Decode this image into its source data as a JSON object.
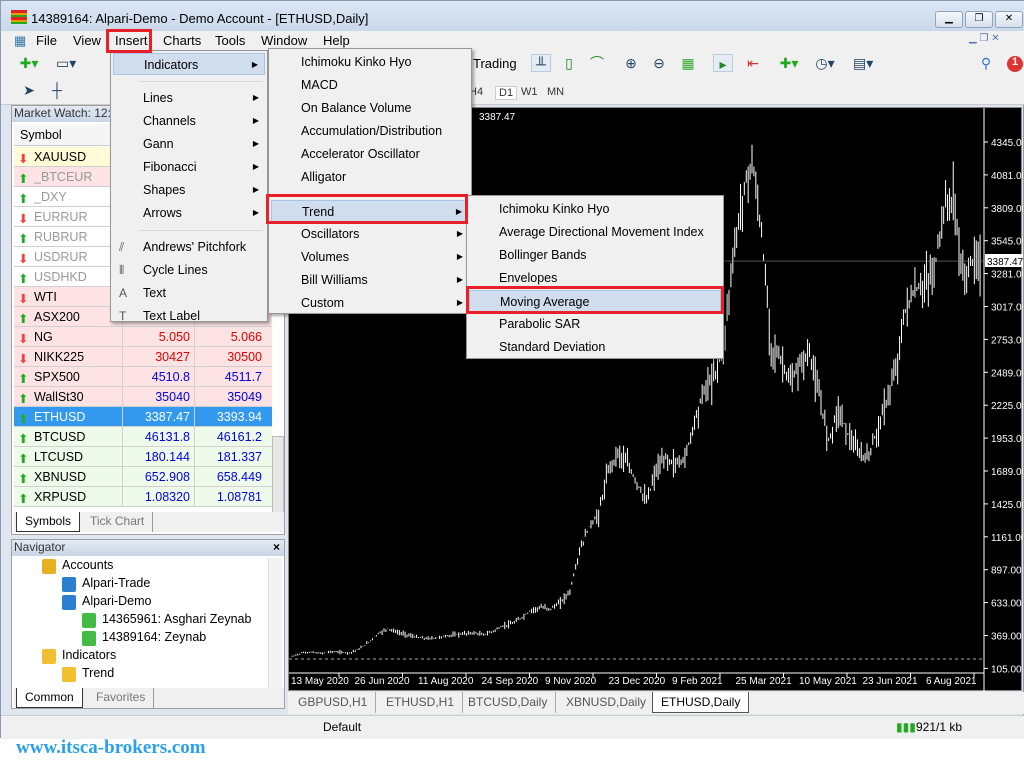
{
  "window": {
    "title": "14389164: Alpari-Demo - Demo Account - [ETHUSD,Daily]"
  },
  "menubar": [
    "File",
    "View",
    "Insert",
    "Charts",
    "Tools",
    "Window",
    "Help"
  ],
  "toolbar": {
    "autotrading_label": "Trading",
    "timeframes": [
      "H4",
      "D1",
      "W1",
      "MN"
    ],
    "notification_count": "1"
  },
  "market_watch": {
    "title": "Market Watch: 12:5",
    "col_symbol": "Symbol",
    "rows": [
      {
        "symbol": "XAUUSD",
        "dir": "down",
        "bid": "",
        "ask": "",
        "bg": "#fffbd6"
      },
      {
        "symbol": "_BTCEUR",
        "dir": "up",
        "bid": "",
        "ask": "",
        "bg": "#fde3e3",
        "dim": true
      },
      {
        "symbol": "_DXY",
        "dir": "up",
        "bid": "",
        "ask": "",
        "bg": "#ffffff",
        "dim": true
      },
      {
        "symbol": "EURRUR",
        "dir": "down",
        "bid": "",
        "ask": "",
        "bg": "#ffffff",
        "dim": true
      },
      {
        "symbol": "RUBRUR",
        "dir": "up",
        "bid": "",
        "ask": "",
        "bg": "#ffffff",
        "dim": true
      },
      {
        "symbol": "USDRUR",
        "dir": "down",
        "bid": "",
        "ask": "",
        "bg": "#ffffff",
        "dim": true
      },
      {
        "symbol": "USDHKD",
        "dir": "up",
        "bid": "",
        "ask": "",
        "bg": "#ffffff",
        "dim": true
      },
      {
        "symbol": "WTI",
        "dir": "down",
        "bid": "",
        "ask": "",
        "bg": "#fde3e3"
      },
      {
        "symbol": "ASX200",
        "dir": "up",
        "bid": "",
        "ask": "",
        "bg": "#fde3e3"
      },
      {
        "symbol": "NG",
        "dir": "down",
        "bid": "5.050",
        "ask": "5.066",
        "bg": "#fde3e3",
        "color": "#e00000"
      },
      {
        "symbol": "NIKK225",
        "dir": "down",
        "bid": "30427",
        "ask": "30500",
        "bg": "#fde3e3",
        "color": "#e00000"
      },
      {
        "symbol": "SPX500",
        "dir": "up",
        "bid": "4510.8",
        "ask": "4511.7",
        "bg": "#fde3e3",
        "color": "#0000e0"
      },
      {
        "symbol": "WallSt30",
        "dir": "up",
        "bid": "35040",
        "ask": "35049",
        "bg": "#fde3e3",
        "color": "#0000e0"
      },
      {
        "symbol": "ETHUSD",
        "dir": "up",
        "bid": "3387.47",
        "ask": "3393.94",
        "bg": "#3399ee",
        "color": "#ffffff",
        "selected": true
      },
      {
        "symbol": "BTCUSD",
        "dir": "up",
        "bid": "46131.8",
        "ask": "46161.2",
        "bg": "#eefbea",
        "color": "#0000e0"
      },
      {
        "symbol": "LTCUSD",
        "dir": "up",
        "bid": "180.144",
        "ask": "181.337",
        "bg": "#eefbea",
        "color": "#0000e0"
      },
      {
        "symbol": "XBNUSD",
        "dir": "up",
        "bid": "652.908",
        "ask": "658.449",
        "bg": "#eefbea",
        "color": "#0000e0"
      },
      {
        "symbol": "XRPUSD",
        "dir": "up",
        "bid": "1.08320",
        "ask": "1.08781",
        "bg": "#eefbea",
        "color": "#0000e0"
      }
    ],
    "tabs": [
      "Symbols",
      "Tick Chart"
    ]
  },
  "navigator": {
    "title": "Navigator",
    "close": "×",
    "items": [
      {
        "label": "Accounts",
        "level": 0,
        "icon": "accounts-icon"
      },
      {
        "label": "Alpari-Trade",
        "level": 1,
        "icon": "server-icon"
      },
      {
        "label": "Alpari-Demo",
        "level": 1,
        "icon": "server-icon"
      },
      {
        "label": "14365961: Asghari Zeynab",
        "level": 2,
        "icon": "user-icon"
      },
      {
        "label": "14389164: Zeynab",
        "level": 2,
        "icon": "user-icon"
      },
      {
        "label": "Indicators",
        "level": 0,
        "icon": "indicator-icon"
      },
      {
        "label": "Trend",
        "level": 1,
        "icon": "indicator-icon"
      }
    ],
    "tabs": [
      "Common",
      "Favorites"
    ]
  },
  "insert_menu": {
    "items": [
      {
        "label": "Indicators",
        "sub": true,
        "highlight": true
      },
      {
        "sep": true
      },
      {
        "label": "Lines",
        "sub": true
      },
      {
        "label": "Channels",
        "sub": true
      },
      {
        "label": "Gann",
        "sub": true
      },
      {
        "label": "Fibonacci",
        "sub": true
      },
      {
        "label": "Shapes",
        "sub": true
      },
      {
        "label": "Arrows",
        "sub": true
      },
      {
        "sep": true
      },
      {
        "label": "Andrews' Pitchfork",
        "icon": "pitchfork-icon",
        "glyph": "⫽"
      },
      {
        "label": "Cycle Lines",
        "icon": "cycle-lines-icon",
        "glyph": "⦀"
      },
      {
        "label": "Text",
        "icon": "text-icon",
        "glyph": "A"
      },
      {
        "label": "Text Label",
        "icon": "text-label-icon",
        "glyph": "T"
      }
    ]
  },
  "indicators_menu": {
    "items": [
      {
        "label": "Ichimoku Kinko Hyo"
      },
      {
        "label": "MACD"
      },
      {
        "label": "On Balance Volume"
      },
      {
        "label": "Accumulation/Distribution"
      },
      {
        "label": "Accelerator Oscillator"
      },
      {
        "label": "Alligator"
      },
      {
        "sep": true
      },
      {
        "label": "Trend",
        "sub": true,
        "highlight": true
      },
      {
        "label": "Oscillators",
        "sub": true
      },
      {
        "label": "Volumes",
        "sub": true
      },
      {
        "label": "Bill Williams",
        "sub": true
      },
      {
        "label": "Custom",
        "sub": true
      }
    ]
  },
  "trend_menu": {
    "items": [
      {
        "label": "Ichimoku Kinko Hyo"
      },
      {
        "label": "Average Directional Movement Index"
      },
      {
        "label": "Bollinger Bands"
      },
      {
        "label": "Envelopes"
      },
      {
        "label": "Moving Average",
        "highlight": true
      },
      {
        "label": "Parabolic SAR"
      },
      {
        "label": "Standard Deviation"
      }
    ]
  },
  "chart": {
    "info": "3387.47",
    "current_price": "3387.47",
    "price_labels": [
      "4345.00",
      "4081.00",
      "3809.00",
      "3545.00",
      "3281.00",
      "3017.00",
      "2753.00",
      "2489.00",
      "2225.00",
      "1953.00",
      "1689.00",
      "1425.00",
      "1161.00",
      "897.00",
      "633.00",
      "369.00",
      "105.00"
    ],
    "date_labels": [
      "13 May 2020",
      "26 Jun 2020",
      "11 Aug 2020",
      "24 Sep 2020",
      "9 Nov 2020",
      "23 Dec 2020",
      "9 Feb 2021",
      "25 Mar 2021",
      "10 May 2021",
      "23 Jun 2021",
      "6 Aug 2021"
    ],
    "ylim": [
      105,
      4345
    ],
    "colors": {
      "background": "#000000",
      "bars": "#ffffff",
      "grid": "#aaaaaa"
    }
  },
  "chart_data": {
    "type": "bar",
    "style": "ohlc",
    "symbol": "ETHUSD",
    "timeframe": "Daily",
    "ylim": [
      105,
      4345
    ],
    "closes": [
      205,
      235,
      240,
      230,
      245,
      240,
      235,
      265,
      320,
      390,
      430,
      400,
      380,
      360,
      350,
      355,
      370,
      380,
      390,
      395,
      380,
      410,
      450,
      470,
      520,
      580,
      600,
      590,
      640,
      730,
      1050,
      1250,
      1350,
      1700,
      1850,
      1750,
      1600,
      1450,
      1700,
      1800,
      1750,
      1800,
      2100,
      2350,
      2450,
      2700,
      3400,
      3900,
      4200,
      3600,
      2700,
      2600,
      2400,
      2550,
      2650,
      2300,
      1950,
      2200,
      2000,
      1850,
      1800,
      2000,
      2250,
      2500,
      3000,
      3150,
      3200,
      3300,
      3800,
      3900,
      3250,
      3387
    ]
  },
  "chart_tabs": [
    "GBPUSD,H1",
    "ETHUSD,H1",
    "BTCUSD,Daily",
    "XBNUSD,Daily",
    "ETHUSD,Daily"
  ],
  "status": {
    "profile": "Default",
    "traffic": "921/1 kb"
  },
  "footer": "www.itsca-brokers.com"
}
